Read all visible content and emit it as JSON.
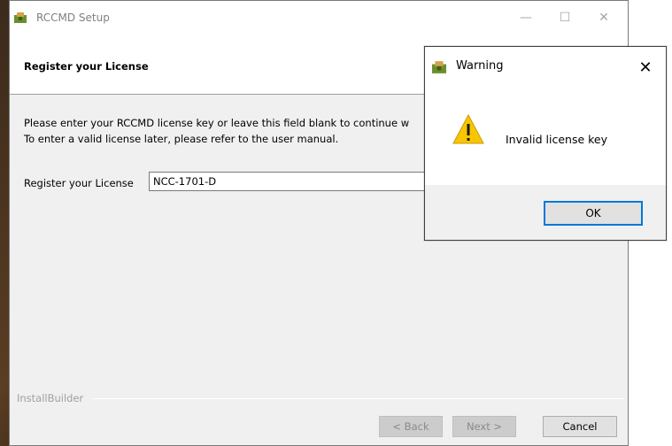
{
  "window": {
    "title": "RCCMD Setup",
    "controls": {
      "minimize": "—",
      "maximize": "☐",
      "close": "✕"
    }
  },
  "page": {
    "title": "Register your License",
    "description_line1": "Please enter your RCCMD license key or leave this field blank to continue w",
    "description_line2": "To enter a valid license later, please refer to the user manual.",
    "field_label": "Register your License",
    "license_value": "NCC-1701-D",
    "footer_brand": "InstallBuilder"
  },
  "buttons": {
    "back": "< Back",
    "next": "Next >",
    "cancel": "Cancel"
  },
  "dialog": {
    "title": "Warning",
    "close": "✕",
    "message": "Invalid license key",
    "ok": "OK"
  },
  "colors": {
    "accent": "#0078d7",
    "warning_yellow": "#f7c600",
    "window_bg": "#f0f0f0"
  },
  "icons": [
    "app-icon",
    "warning-triangle-icon",
    "close-icon"
  ]
}
